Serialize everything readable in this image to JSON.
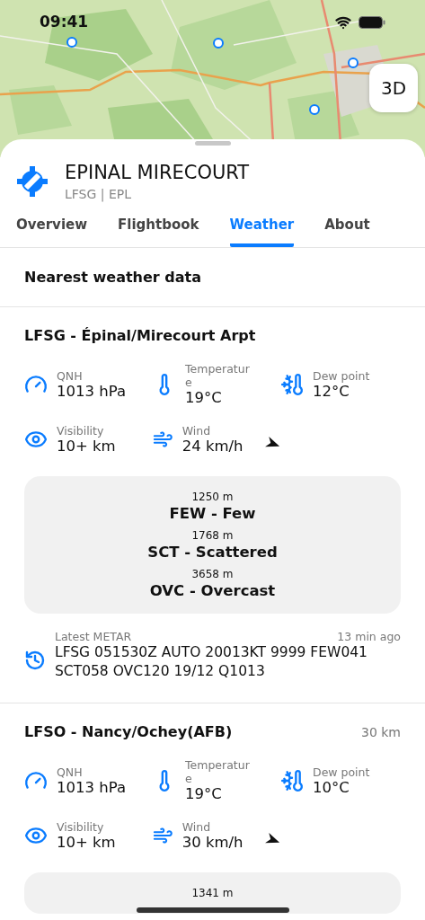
{
  "status_bar": {
    "time": "09:41"
  },
  "map": {
    "kind": "picture",
    "button": "3D"
  },
  "airport": {
    "name": "EPINAL MIRECOURT",
    "codes": "LFSG | EPL"
  },
  "tabs": [
    {
      "label": "Overview",
      "selected": false
    },
    {
      "label": "Flightbook",
      "selected": false
    },
    {
      "label": "Weather",
      "selected": true
    },
    {
      "label": "About",
      "selected": false
    }
  ],
  "section_title": "Nearest weather data",
  "stations": [
    {
      "name": "LFSG - Épinal/Mirecourt Arpt",
      "metrics": [
        {
          "kind": "qnh",
          "label": "QNH",
          "value": "1013 hPa"
        },
        {
          "kind": "temperature",
          "label": "Temperature",
          "value": "19°C"
        },
        {
          "kind": "dew_point",
          "label": "Dew point",
          "value": "12°C"
        },
        {
          "kind": "visibility",
          "label": "Visibility",
          "value": "10+ km"
        },
        {
          "kind": "wind",
          "label": "Wind",
          "value": "24 km/h"
        }
      ],
      "clouds": [
        {
          "altitude": "1250 m",
          "layer": "FEW - Few"
        },
        {
          "altitude": "1768 m",
          "layer": "SCT - Scattered"
        },
        {
          "altitude": "3658 m",
          "layer": "OVC - Overcast"
        }
      ],
      "metar": {
        "label": "Latest METAR",
        "age": "13 min ago",
        "text": "LFSG 051530Z AUTO 20013KT 9999 FEW041 SCT058 OVC120 19/12 Q1013"
      }
    },
    {
      "name": "LFSO - Nancy/Ochey(AFB)",
      "distance": "30 km",
      "metrics": [
        {
          "kind": "qnh",
          "label": "QNH",
          "value": "1013 hPa"
        },
        {
          "kind": "temperature",
          "label": "Temperature",
          "value": "19°C"
        },
        {
          "kind": "dew_point",
          "label": "Dew point",
          "value": "10°C"
        },
        {
          "kind": "visibility",
          "label": "Visibility",
          "value": "10+ km"
        },
        {
          "kind": "wind",
          "label": "Wind",
          "value": "30 km/h"
        }
      ],
      "clouds": [
        {
          "altitude": "1341 m"
        }
      ]
    }
  ]
}
